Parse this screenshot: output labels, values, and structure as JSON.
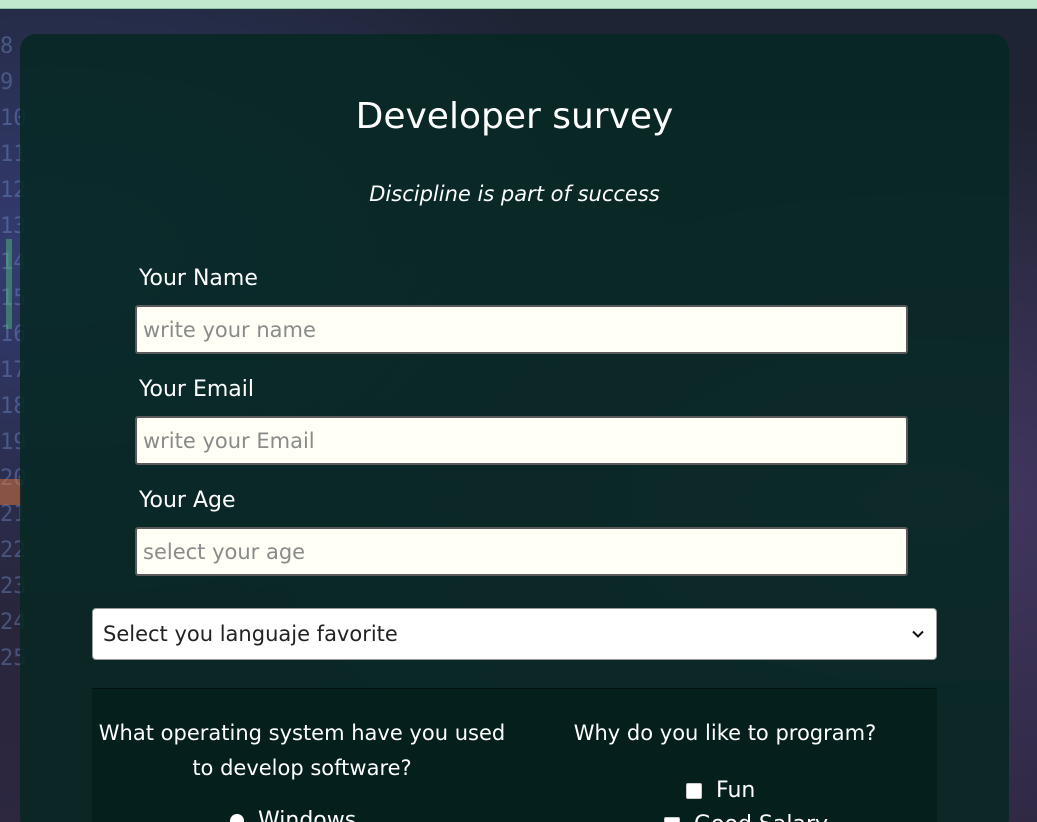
{
  "survey": {
    "title": "Developer survey",
    "subtitle": "Discipline is part of success"
  },
  "fields": {
    "name": {
      "label": "Your Name",
      "placeholder": "write your name"
    },
    "email": {
      "label": "Your Email",
      "placeholder": "write your Email"
    },
    "age": {
      "label": "Your Age",
      "placeholder": "select your age"
    }
  },
  "language_select": {
    "selected": "Select you languaje favorite"
  },
  "os_question": {
    "text": "What operating system have you used to develop software?",
    "options": [
      "Windows"
    ]
  },
  "why_question": {
    "text": "Why do you like to program?",
    "options": [
      "Fun",
      "Good Salary"
    ]
  },
  "colors": {
    "topbar": "#bfe8cf",
    "card": "#06281f",
    "input_bg": "#fffff6"
  }
}
